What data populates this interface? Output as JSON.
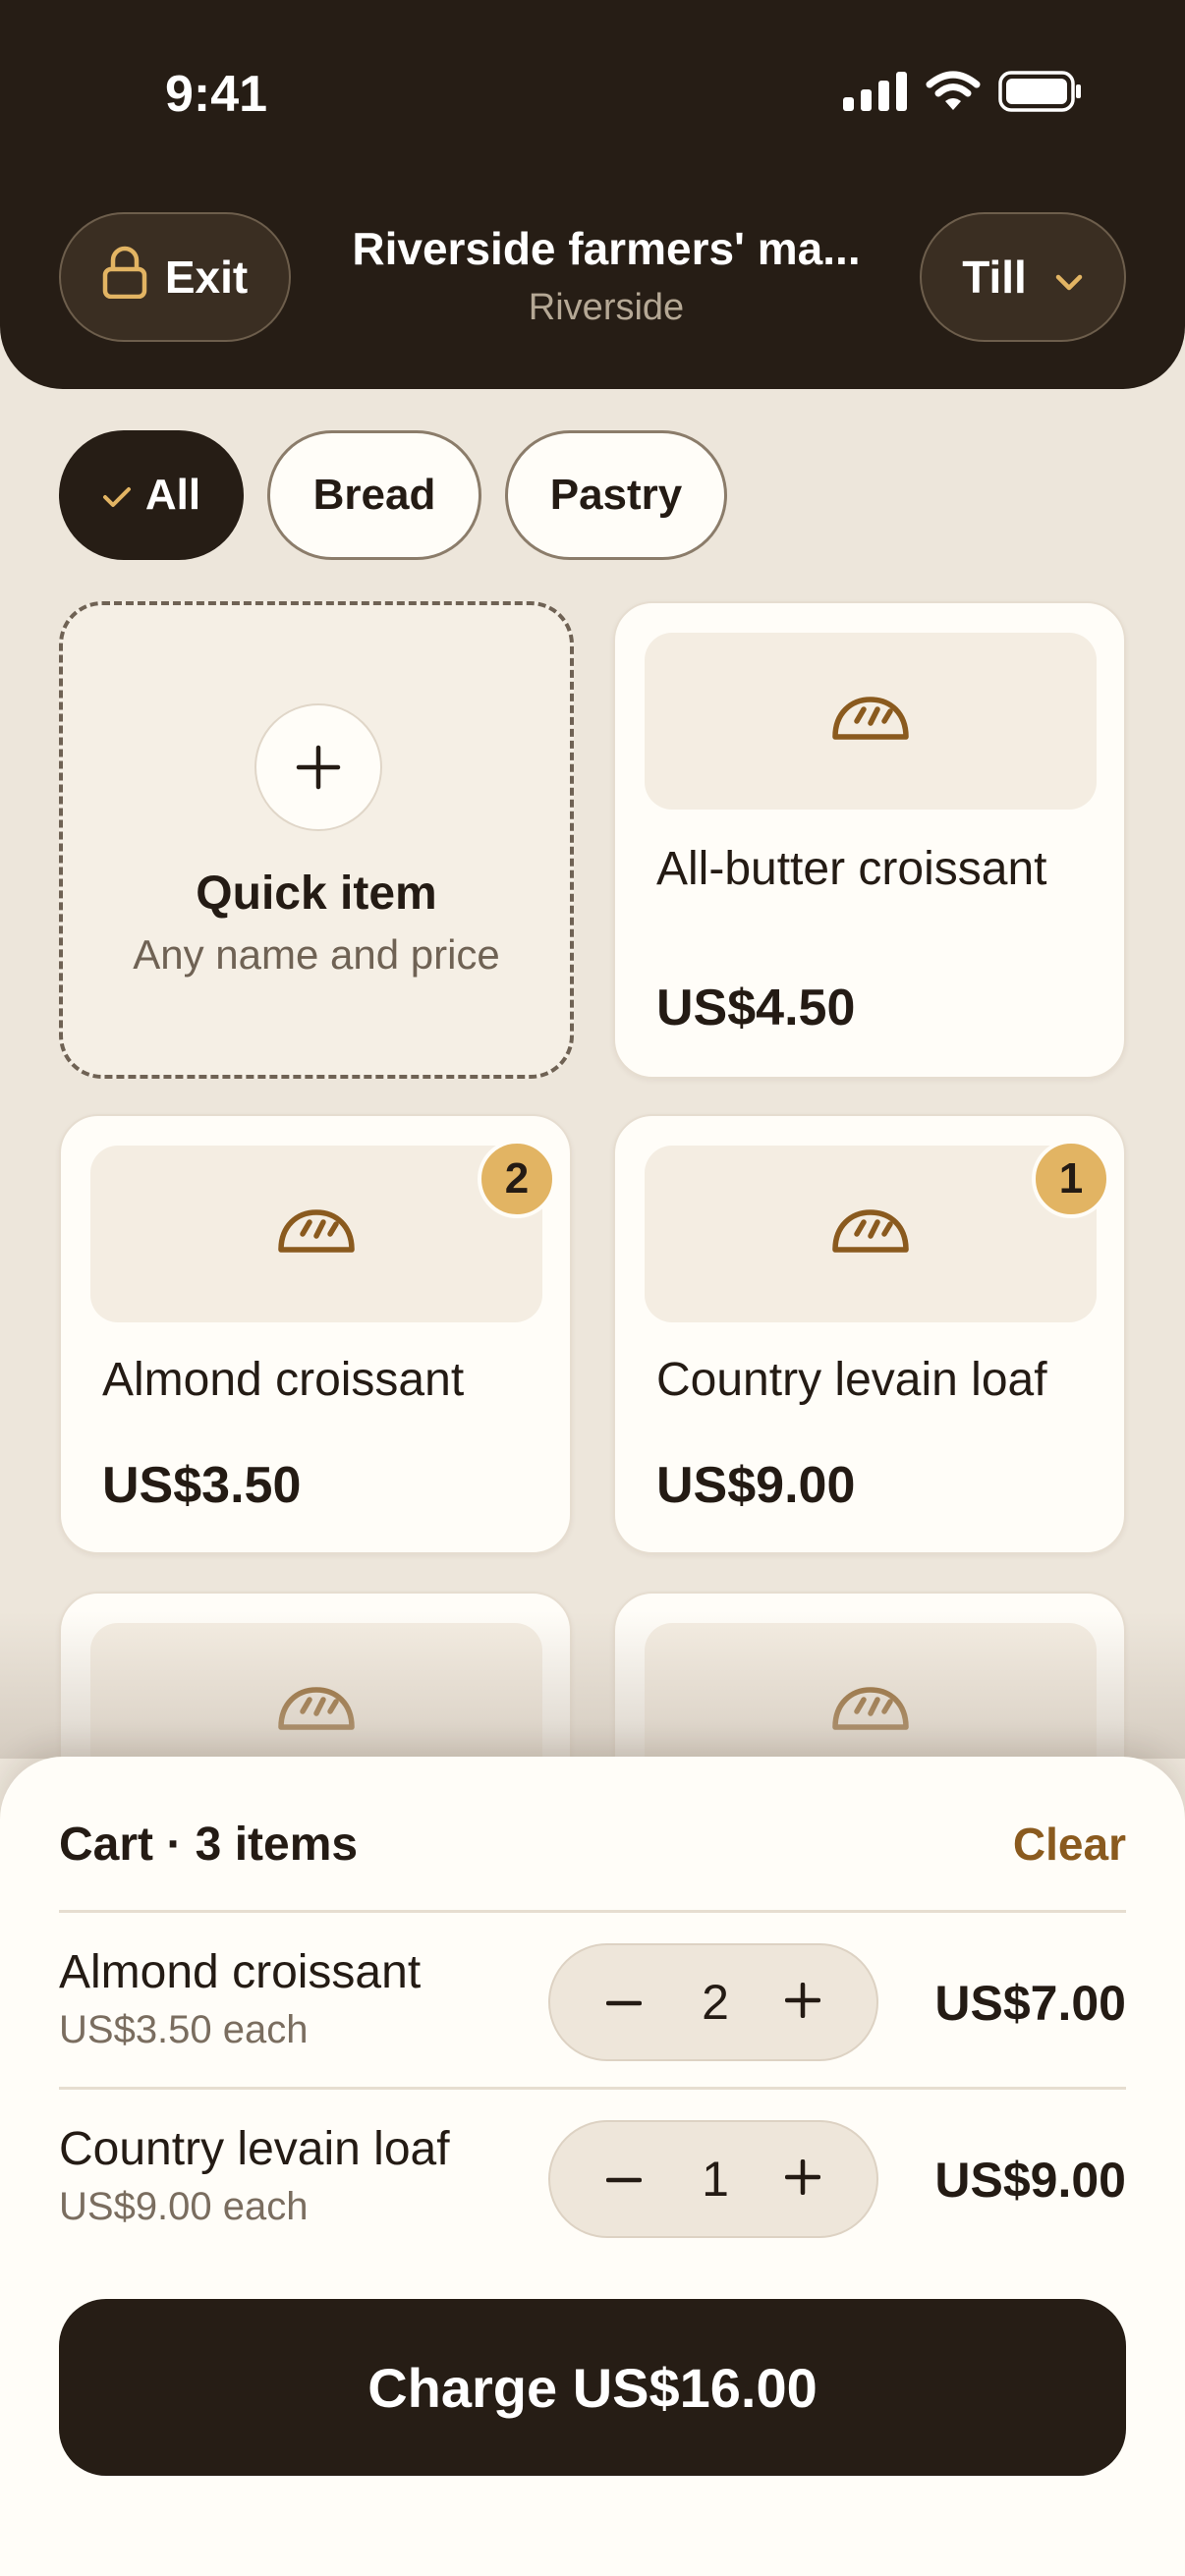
{
  "status_bar": {
    "time": "9:41"
  },
  "header": {
    "exit_label": "Exit",
    "market_name": "Riverside farmers' ma...",
    "location": "Riverside",
    "register_label": "Till"
  },
  "filters": [
    {
      "label": "All",
      "selected": true
    },
    {
      "label": "Bread",
      "selected": false
    },
    {
      "label": "Pastry",
      "selected": false
    }
  ],
  "quick_item": {
    "title": "Quick item",
    "subtitle": "Any name and price"
  },
  "products": [
    {
      "name": "All-butter croissant",
      "price": "US$4.50",
      "in_cart": null,
      "icon": "bread-icon"
    },
    {
      "name": "Almond croissant",
      "price": "US$3.50",
      "in_cart": "2",
      "icon": "bread-icon"
    },
    {
      "name": "Country levain loaf",
      "price": "US$9.00",
      "in_cart": "1",
      "icon": "bread-icon"
    }
  ],
  "cart": {
    "title": "Cart · 3 items",
    "clear_label": "Clear",
    "lines": [
      {
        "name": "Almond croissant",
        "each": "US$3.50 each",
        "qty": "2",
        "total": "US$7.00"
      },
      {
        "name": "Country levain loaf",
        "each": "US$9.00 each",
        "qty": "1",
        "total": "US$9.00"
      }
    ],
    "charge_label": "Charge US$16.00"
  },
  "colors": {
    "header_bg": "#261d15",
    "page_bg": "#ede6db",
    "badge": "#e2b463",
    "accent_text": "#8a5a1e"
  }
}
